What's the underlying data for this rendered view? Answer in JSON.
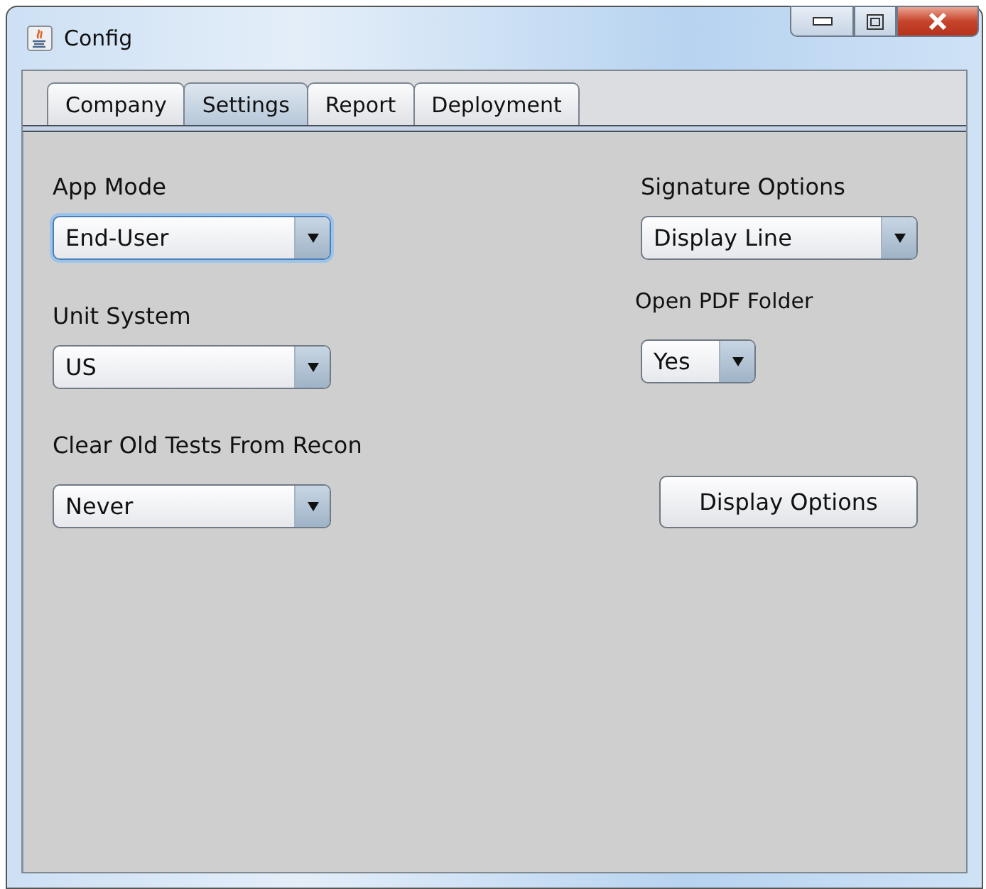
{
  "window": {
    "title": "Config"
  },
  "tabs": [
    {
      "label": "Company",
      "selected": false
    },
    {
      "label": "Settings",
      "selected": true
    },
    {
      "label": "Report",
      "selected": false
    },
    {
      "label": "Deployment",
      "selected": false
    }
  ],
  "left_fields": [
    {
      "label": "App Mode",
      "value": "End-User",
      "focused": true
    },
    {
      "label": "Unit System",
      "value": "US",
      "focused": false
    },
    {
      "label": "Clear Old Tests From Recon",
      "value": "Never",
      "focused": false
    }
  ],
  "right_fields": [
    {
      "label": "Signature Options",
      "value": "Display Line",
      "focused": false
    },
    {
      "label": "Open PDF Folder",
      "value": "Yes",
      "focused": false
    }
  ],
  "buttons": [
    {
      "label": "Display Options"
    }
  ]
}
